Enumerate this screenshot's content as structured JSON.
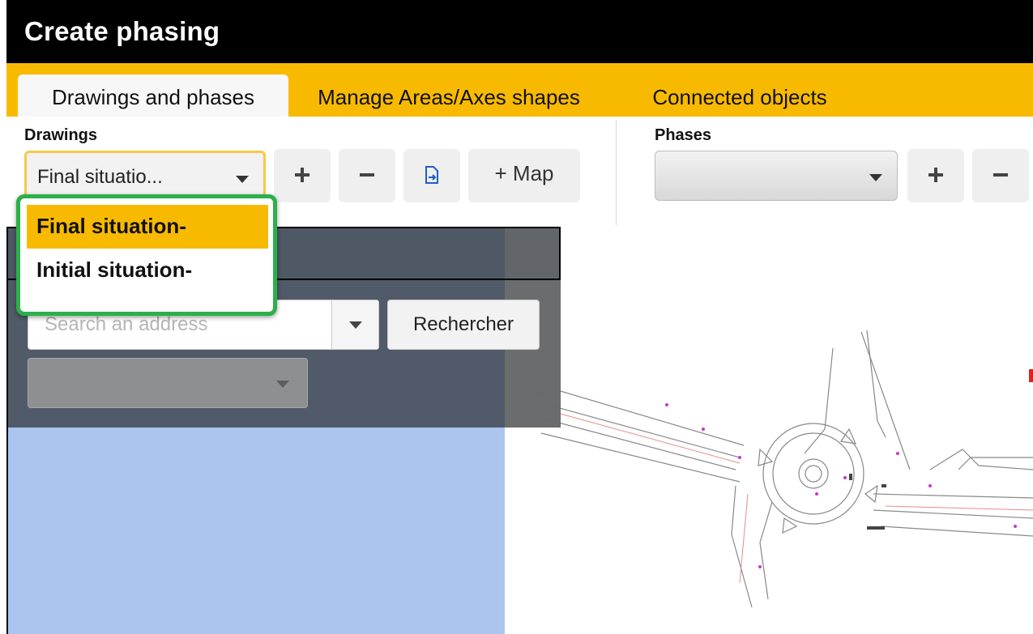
{
  "window": {
    "title": "Create phasing"
  },
  "tabs": [
    {
      "label": "Drawings and phases",
      "active": true
    },
    {
      "label": "Manage Areas/Axes shapes",
      "active": false
    },
    {
      "label": "Connected objects",
      "active": false
    }
  ],
  "drawings": {
    "group_label": "Drawings",
    "selected_value": "Final situatio...",
    "options": [
      "Final situation-",
      "Initial situation-"
    ],
    "add_icon": "plus-icon",
    "remove_icon": "minus-icon",
    "file_icon": "file-arrow-icon",
    "map_button_label": "+ Map"
  },
  "phases": {
    "group_label": "Phases",
    "selected_value": "",
    "add_icon": "plus-icon",
    "remove_icon": "minus-icon"
  },
  "map_panel": {
    "search_placeholder": "Search an address",
    "search_button_label": "Rechercher",
    "sub_select_value": ""
  },
  "colors": {
    "accent": "#f8ba00",
    "titlebar": "#000000",
    "dropdown_highlight": "#2bb04a",
    "map_blue": "#abc5ef"
  }
}
